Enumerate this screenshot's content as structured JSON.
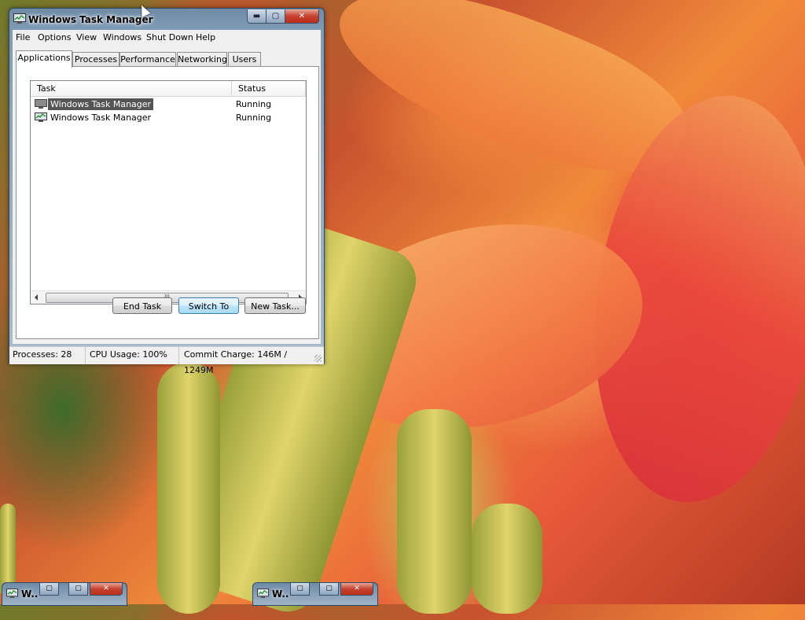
{
  "window": {
    "title": "Windows Task Manager",
    "controls": {
      "minimize": "▬",
      "maximize": "▢",
      "close": "✕"
    }
  },
  "menu": [
    "File",
    "Options",
    "View",
    "Windows",
    "Shut Down",
    "Help"
  ],
  "tabs": [
    "Applications",
    "Processes",
    "Performance",
    "Networking",
    "Users"
  ],
  "active_tab": "Applications",
  "task_list": {
    "headers": {
      "task": "Task",
      "status": "Status"
    },
    "rows": [
      {
        "task": "Windows Task Manager",
        "status": "Running",
        "selected": true
      },
      {
        "task": "Windows Task Manager",
        "status": "Running",
        "selected": false
      }
    ],
    "scroll_thumb": "III"
  },
  "buttons": {
    "end_task": "End Task",
    "switch_to": "Switch To",
    "new_task": "New Task..."
  },
  "statusbar": {
    "processes": "Processes: 28",
    "cpu": "CPU Usage: 100%",
    "commit": "Commit Charge: 146M / 1249M"
  },
  "minimized_windows": [
    {
      "title": "W.."
    },
    {
      "title": "W.."
    }
  ],
  "icons": {
    "app": "task-manager-icon"
  },
  "colors": {
    "selection": "#555555",
    "close_button": "#c7412e",
    "focus_button": "#3c7fb1"
  }
}
